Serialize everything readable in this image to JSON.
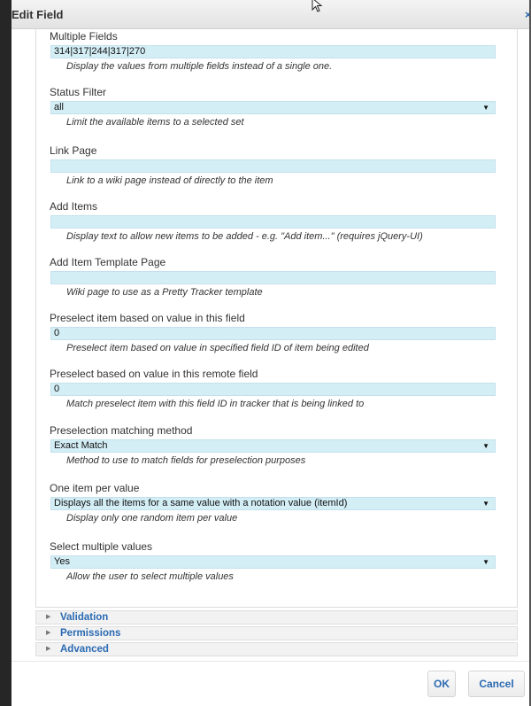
{
  "dialog": {
    "title": "Edit Field",
    "close_glyph": "×"
  },
  "fields": [
    {
      "label": "Multiple Fields",
      "value": "314|317|244|317|270",
      "description": "Display the values from multiple fields instead of a single one."
    },
    {
      "label": "Status Filter",
      "value": "all",
      "description": "Limit the available items to a selected set"
    },
    {
      "label": "Link Page",
      "value": "",
      "description": "Link to a wiki page instead of directly to the item"
    },
    {
      "label": "Add Items",
      "value": "",
      "description": "Display text to allow new items to be added - e.g. \"Add item...\" (requires jQuery-UI)"
    },
    {
      "label": "Add Item Template Page",
      "value": "",
      "description": "Wiki page to use as a Pretty Tracker template"
    },
    {
      "label": "Preselect item based on value in this field",
      "value": "0",
      "description": "Preselect item based on value in specified field ID of item being edited"
    },
    {
      "label": "Preselect based on value in this remote field",
      "value": "0",
      "description": "Match preselect item with this field ID in tracker that is being linked to"
    },
    {
      "label": "Preselection matching method",
      "value": "Exact Match",
      "description": "Method to use to match fields for preselection purposes"
    },
    {
      "label": "One item per value",
      "value": "Displays all the items for a same value with a notation value (itemId)",
      "description": "Display only one random item per value"
    },
    {
      "label": "Select multiple values",
      "value": "Yes",
      "description": "Allow the user to select multiple values"
    }
  ],
  "sections": [
    {
      "label": "Validation"
    },
    {
      "label": "Permissions"
    },
    {
      "label": "Advanced"
    }
  ],
  "buttons": {
    "ok_label": "OK",
    "cancel_label": "Cancel"
  },
  "colors": {
    "accent": "#2a6ab2",
    "input_bg": "#d4eef6"
  },
  "icons": {
    "select_arrow": "select-arrow-icon",
    "section_toggle": "triangle-right-icon",
    "cursor": "cursor-arrow-icon",
    "close": "close-icon"
  }
}
